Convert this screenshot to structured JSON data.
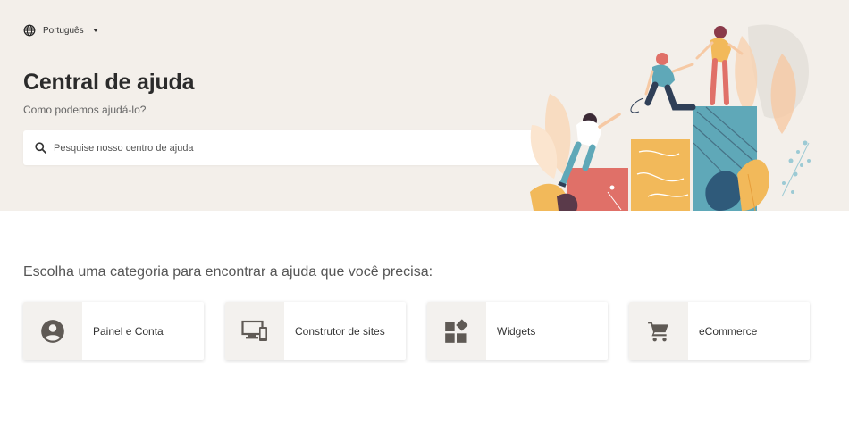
{
  "language": {
    "label": "Português",
    "icon": "globe-icon"
  },
  "hero": {
    "title": "Central de ajuda",
    "subtitle": "Como podemos ajudá-lo?",
    "search_placeholder": "Pesquise nosso centro de ajuda"
  },
  "categories_heading": "Escolha uma categoria para encontrar a ajuda que você precisa:",
  "categories": [
    {
      "label": "Painel e Conta",
      "icon": "account-icon"
    },
    {
      "label": "Construtor de sites",
      "icon": "devices-icon"
    },
    {
      "label": "Widgets",
      "icon": "widgets-icon"
    },
    {
      "label": "eCommerce",
      "icon": "cart-icon"
    }
  ],
  "colors": {
    "hero_bg": "#f3efea",
    "icon_bg": "#f3f1ee",
    "icon": "#5f5a55",
    "coral": "#e07068",
    "mustard": "#f2b95a",
    "teal": "#5fa8b8",
    "navy": "#2f3f57"
  }
}
